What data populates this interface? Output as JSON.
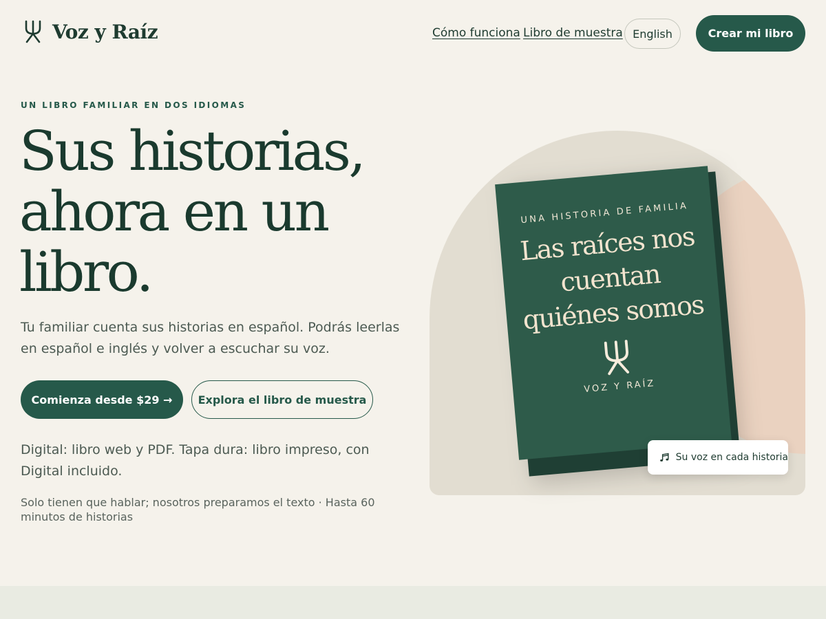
{
  "brand": {
    "name": "Voz y Raíz",
    "mark_icon": "tree-roots-icon"
  },
  "nav": {
    "how_it_works": "Cómo funciona",
    "sample_book": "Libro de muestra",
    "language": "English",
    "create": "Crear mi libro"
  },
  "hero": {
    "eyebrow": "UN LIBRO FAMILIAR EN DOS IDIOMAS",
    "headline": "Sus historias, ahora en un libro.",
    "lead": "Tu familiar cuenta sus historias en español. Podrás leerlas en español e inglés y volver a escuchar su voz.",
    "cta_primary": "Comienza desde $29 →",
    "cta_secondary": "Explora el libro de muestra",
    "formats": "Digital: libro web y PDF. Tapa dura: libro impreso, con Digital incluido.",
    "footnote": "Solo tienen que hablar; nosotros preparamos el texto · Hasta 60 minutos de historias"
  },
  "book": {
    "eyebrow": "UNA HISTORIA DE FAMILIA",
    "title": "Las raíces nos cuentan quiénes somos",
    "brand": "VOZ Y RAÍZ"
  },
  "badge": {
    "label": "Su voz en cada historia",
    "icon": "music-note-icon"
  },
  "colors": {
    "background": "#f5f2eb",
    "primary": "#26594a",
    "heading": "#1a3a2e",
    "book_cover": "#2e5b4a",
    "accent_peach": "#ead2c0"
  }
}
